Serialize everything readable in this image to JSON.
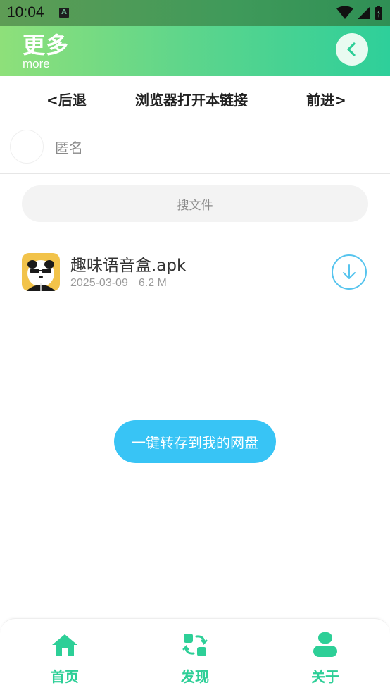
{
  "status_bar": {
    "time": "10:04",
    "sim_badge": "A"
  },
  "header": {
    "title": "更多",
    "subtitle": "more",
    "back_icon": "chevron-left-icon"
  },
  "nav": {
    "back_label": "<后退",
    "open_browser_label": "浏览器打开本链接",
    "forward_label": "前进>"
  },
  "user": {
    "name": "匿名"
  },
  "search": {
    "placeholder": "搜文件"
  },
  "files": [
    {
      "name": "趣味语音盒.apk",
      "date": "2025-03-09",
      "size": "6.2 M",
      "action_icon": "download-icon"
    }
  ],
  "save_button": {
    "label": "一键转存到我的网盘"
  },
  "bottom_nav": {
    "items": [
      {
        "label": "首页",
        "icon": "home-icon"
      },
      {
        "label": "发现",
        "icon": "discover-icon"
      },
      {
        "label": "关于",
        "icon": "user-icon"
      }
    ]
  },
  "colors": {
    "accent": "#2dcf97",
    "button": "#38c4f5",
    "header_start": "#8ee07a",
    "header_end": "#2ecf9a"
  }
}
